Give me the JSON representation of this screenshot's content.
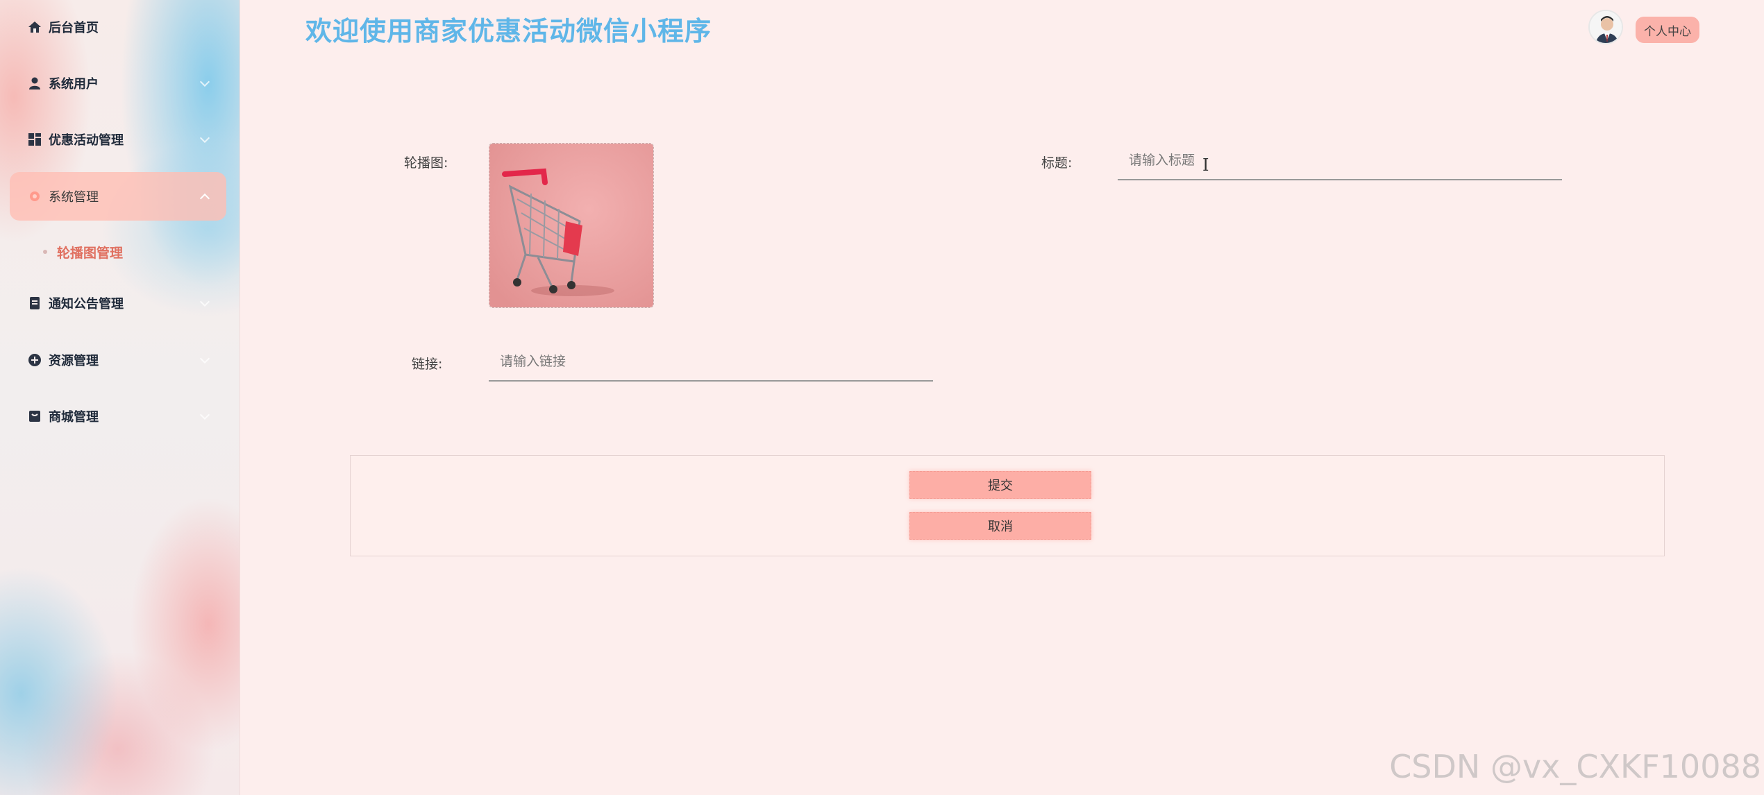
{
  "app": {
    "title": "欢迎使用商家优惠活动微信小程序"
  },
  "header": {
    "profile_label": "个人中心"
  },
  "sidebar": {
    "items": [
      {
        "label": "后台首页",
        "icon": "home-icon"
      },
      {
        "label": "系统用户",
        "icon": "user-icon"
      },
      {
        "label": "优惠活动管理",
        "icon": "grid-icon"
      },
      {
        "label": "系统管理",
        "icon": "gear-icon",
        "active": true
      },
      {
        "label": "通知公告管理",
        "icon": "document-icon"
      },
      {
        "label": "资源管理",
        "icon": "plus-circle-icon"
      },
      {
        "label": "商城管理",
        "icon": "shop-icon"
      }
    ],
    "sub_items": [
      {
        "label": "轮播图管理"
      }
    ]
  },
  "form": {
    "carousel_label": "轮播图:",
    "title_label": "标题:",
    "title_placeholder": "请输入标题",
    "link_label": "链接:",
    "link_placeholder": "请输入链接",
    "image_icon": "shopping-cart-icon"
  },
  "actions": {
    "submit_label": "提交",
    "cancel_label": "取消"
  },
  "watermark": "CSDN @vx_CXKF10088",
  "colors": {
    "accent": "#fdaea6",
    "title": "#5fb6e8",
    "active_nav": "#ffbeb4"
  }
}
